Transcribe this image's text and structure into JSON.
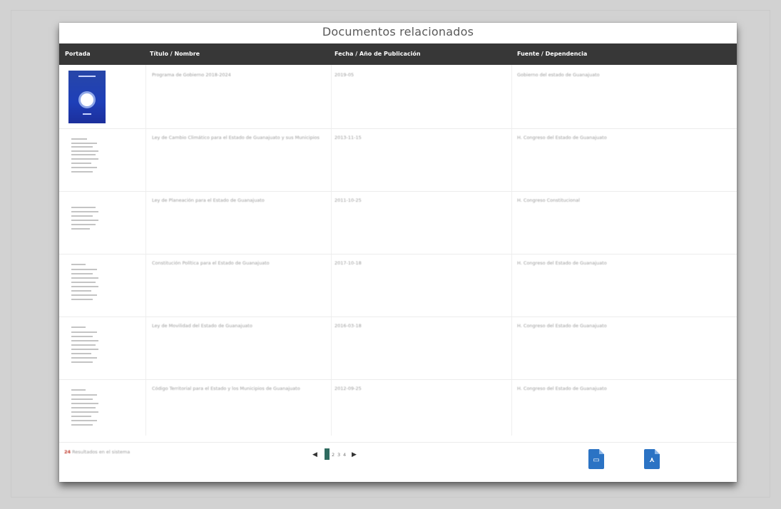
{
  "title": "Documentos relacionados",
  "columns": [
    "Portada",
    "Título / Nombre",
    "Fecha / Año de Publicación",
    "Fuente / Dependencia"
  ],
  "rows": [
    {
      "cover_icon": "blue-cover-icon",
      "title": "Programa de Gobierno 2018-2024",
      "date": "2019-05",
      "source": "Gobierno del estado de Guanajuato"
    },
    {
      "cover_icon": "document-thumbnail-icon",
      "title": "Ley de Cambio Climático para el Estado de Guanajuato y sus Municipios",
      "date": "2013-11-15",
      "source": "H. Congreso del Estado de Guanajuato"
    },
    {
      "cover_icon": "document-thumbnail-icon",
      "title": "Ley de Planeación para el Estado de Guanajuato",
      "date": "2011-10-25",
      "source": "H. Congreso Constitucional"
    },
    {
      "cover_icon": "document-thumbnail-icon",
      "title": "Constitución Política para el Estado de Guanajuato",
      "date": "2017-10-18",
      "source": "H. Congreso del Estado de Guanajuato"
    },
    {
      "cover_icon": "document-thumbnail-icon",
      "title": "Ley de Movilidad del Estado de Guanajuato",
      "date": "2016-03-18",
      "source": "H. Congreso del Estado de Guanajuato"
    },
    {
      "cover_icon": "document-thumbnail-icon",
      "title": "Código Territorial para el Estado y los Municipios de Guanajuato",
      "date": "2012-09-25",
      "source": "H. Congreso del Estado de Guanajuato"
    }
  ],
  "footer": {
    "count": "24",
    "results_text": "Resultados en el sistema"
  },
  "pagination": {
    "prev": "◀",
    "pages": [
      "1",
      "2",
      "3",
      "4"
    ],
    "current": "1",
    "next": "▶"
  },
  "export": {
    "csv_icon": "csv-file-icon",
    "pdf_icon": "pdf-file-icon"
  }
}
